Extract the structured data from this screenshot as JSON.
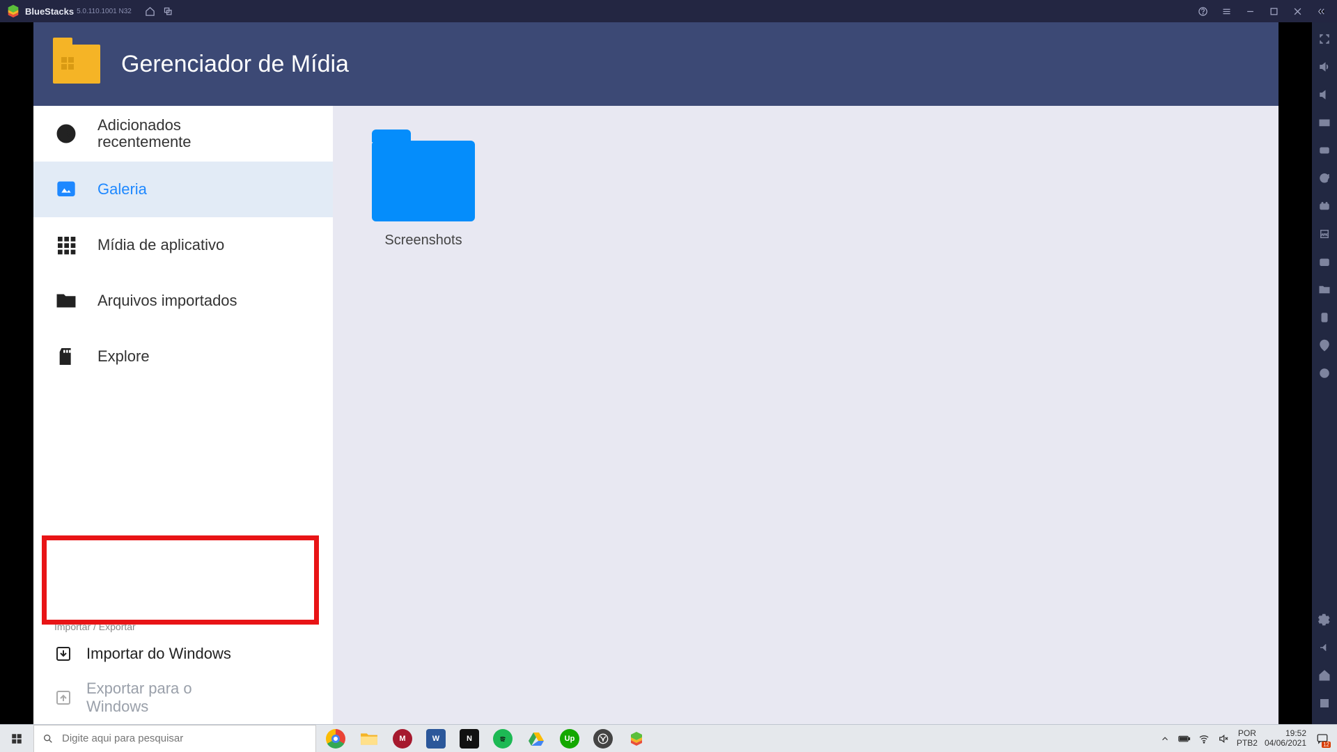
{
  "bluestacks": {
    "title": "BlueStacks",
    "version": "5.0.110.1001 N32"
  },
  "app": {
    "title": "Gerenciador de Mídia",
    "nav": {
      "recent": "Adicionados\nrecentemente",
      "gallery": "Galeria",
      "appmedia": "Mídia de aplicativo",
      "imported": "Arquivos importados",
      "explore": "Explore"
    },
    "section_header": "Importar / Exportar",
    "import": "Importar do Windows",
    "export": "Exportar para o Windows",
    "folder_label": "Screenshots"
  },
  "taskbar": {
    "search_placeholder": "Digite aqui para pesquisar",
    "lang1": "POR",
    "lang2": "PTB2",
    "time": "19:52",
    "date": "04/06/2021",
    "notif_count": "12"
  }
}
